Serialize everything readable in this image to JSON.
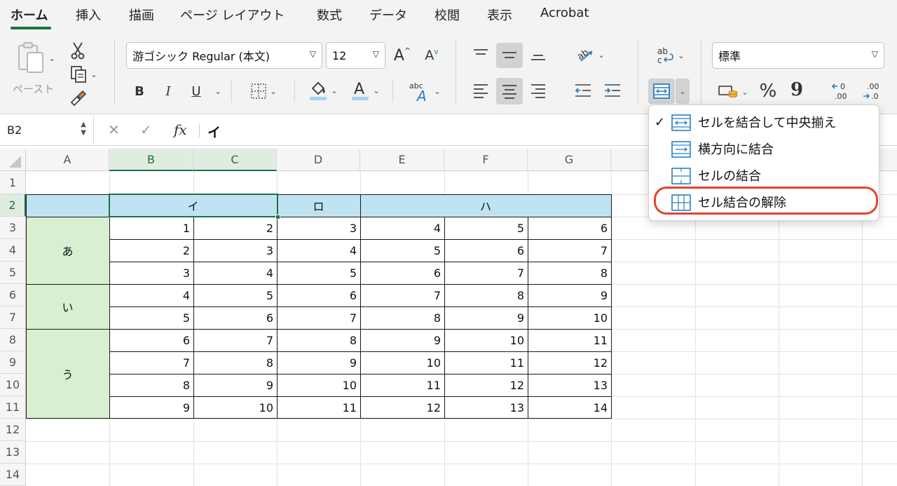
{
  "tabs": [
    "ホーム",
    "挿入",
    "描画",
    "ページ レイアウト",
    "数式",
    "データ",
    "校閲",
    "表示",
    "Acrobat"
  ],
  "ribbon": {
    "paste_label": "ペースト",
    "font_name": "游ゴシック Regular (本文)",
    "font_size": "12",
    "bold": "B",
    "italic": "I",
    "underline": "U",
    "number_format": "標準",
    "percent": "%",
    "comma": "9"
  },
  "formula_bar": {
    "cell_ref": "B2",
    "content": "イ"
  },
  "columns": [
    "A",
    "B",
    "C",
    "D",
    "E",
    "F",
    "G"
  ],
  "rows": [
    "1",
    "2",
    "3",
    "4",
    "5",
    "6",
    "7",
    "8",
    "9",
    "10",
    "11",
    "12",
    "13",
    "14"
  ],
  "table": {
    "headers": [
      "イ",
      "ロ",
      "ハ"
    ],
    "groups": [
      "あ",
      "い",
      "う"
    ],
    "data": [
      [
        "1",
        "2",
        "3",
        "4",
        "5",
        "6"
      ],
      [
        "2",
        "3",
        "4",
        "5",
        "6",
        "7"
      ],
      [
        "3",
        "4",
        "5",
        "6",
        "7",
        "8"
      ],
      [
        "4",
        "5",
        "6",
        "7",
        "8",
        "9"
      ],
      [
        "5",
        "6",
        "7",
        "8",
        "9",
        "10"
      ],
      [
        "6",
        "7",
        "8",
        "9",
        "10",
        "11"
      ],
      [
        "7",
        "8",
        "9",
        "10",
        "11",
        "12"
      ],
      [
        "8",
        "9",
        "10",
        "11",
        "12",
        "13"
      ],
      [
        "9",
        "10",
        "11",
        "12",
        "13",
        "14"
      ]
    ]
  },
  "merge_menu": {
    "items": [
      "セルを結合して中央揃え",
      "横方向に結合",
      "セルの結合",
      "セル結合の解除"
    ],
    "checked_index": 0,
    "highlighted_index": 3
  },
  "colors": {
    "accent_green": "#1e7145",
    "header_blue": "#c0e3f3",
    "group_green": "#d8efd1",
    "highlight_red": "#e2442f",
    "icon_blue": "#2a7fc1"
  }
}
